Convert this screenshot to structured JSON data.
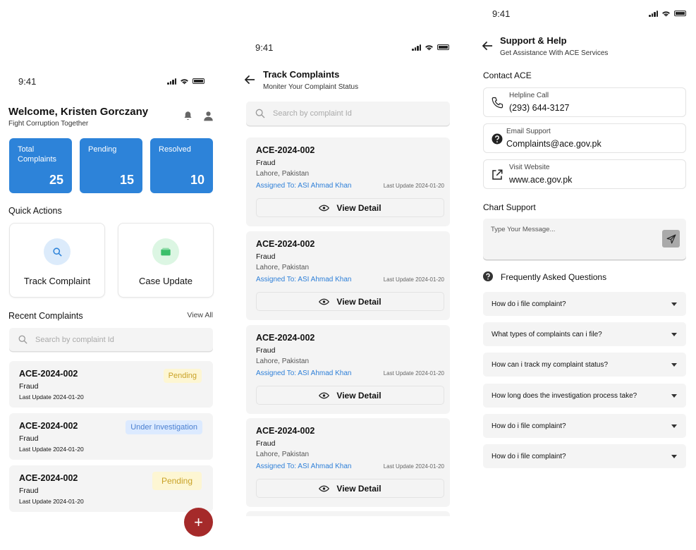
{
  "status_time": "9:41",
  "home": {
    "welcome": "Welcome, Kristen Gorczany",
    "tagline": "Fight Corruption Together",
    "stats": [
      {
        "label_line1": "Total",
        "label_line2": "Complaints",
        "value": "25"
      },
      {
        "label_line1": "Pending",
        "label_line2": "",
        "value": "15"
      },
      {
        "label_line1": "Resolved",
        "label_line2": "",
        "value": "10"
      }
    ],
    "quick_actions_title": "Quick Actions",
    "quick_actions": [
      "Track Complaint",
      "Case Update"
    ],
    "recent_title": "Recent Complaints",
    "view_all": "View All",
    "search_placeholder": "Search by complaint Id",
    "complaints": [
      {
        "id": "ACE-2024-002",
        "type": "Fraud",
        "update": "Last Update 2024-01-20",
        "status": "Pending"
      },
      {
        "id": "ACE-2024-002",
        "type": "Fraud",
        "update": "Last Update 2024-01-20",
        "status": "Under Investigation"
      },
      {
        "id": "ACE-2024-002",
        "type": "Fraud",
        "update": "Last Update 2024-01-20",
        "status": "Pending"
      }
    ],
    "fab": "+"
  },
  "track": {
    "title": "Track Complaints",
    "subtitle": "Moniter Your Complaint Status",
    "search_placeholder": "Search by complaint Id",
    "items": [
      {
        "id": "ACE-2024-002",
        "type": "Fraud",
        "location": "Lahore, Pakistan",
        "assigned": "Assigned To: ASI Ahmad Khan",
        "update": "Last Update 2024-01-20",
        "action": "View Detail"
      },
      {
        "id": "ACE-2024-002",
        "type": "Fraud",
        "location": "Lahore, Pakistan",
        "assigned": "Assigned To: ASI Ahmad Khan",
        "update": "Last Update 2024-01-20",
        "action": "View Detail"
      },
      {
        "id": "ACE-2024-002",
        "type": "Fraud",
        "location": "Lahore, Pakistan",
        "assigned": "Assigned To: ASI Ahmad Khan",
        "update": "Last Update 2024-01-20",
        "action": "View Detail"
      },
      {
        "id": "ACE-2024-002",
        "type": "Fraud",
        "location": "Lahore, Pakistan",
        "assigned": "Assigned To: ASI Ahmad Khan",
        "update": "Last Update 2024-01-20",
        "action": "View Detail"
      }
    ]
  },
  "support": {
    "title": "Support & Help",
    "subtitle": "Get Assistance With ACE Services",
    "contact_title": "Contact ACE",
    "contacts": [
      {
        "label": "Helpline Call",
        "value": "(293) 644-3127",
        "icon": "phone-icon"
      },
      {
        "label": "Email Support",
        "value": "Complaints@ace.gov.pk",
        "icon": "help-circle-icon"
      },
      {
        "label": "Visit Website",
        "value": "www.ace.gov.pk",
        "icon": "external-link-icon"
      }
    ],
    "chat_title": "Chart Support",
    "chat_placeholder": "Type Your Message...",
    "faq_title": "Frequently Asked Questions",
    "faqs": [
      "How do i file  complaint?",
      "What types of complaints can i file?",
      "How can i track my complaint status?",
      "How long does the investigation process take?",
      "How do i file  complaint?",
      "How do i file  complaint?"
    ]
  },
  "colors": {
    "primary": "#2d83d9",
    "fab": "#a52a2a",
    "pending_bg": "#fdf6d3",
    "pending_fg": "#c9a227",
    "investigation_bg": "#dceaff",
    "investigation_fg": "#4a7fd0"
  }
}
